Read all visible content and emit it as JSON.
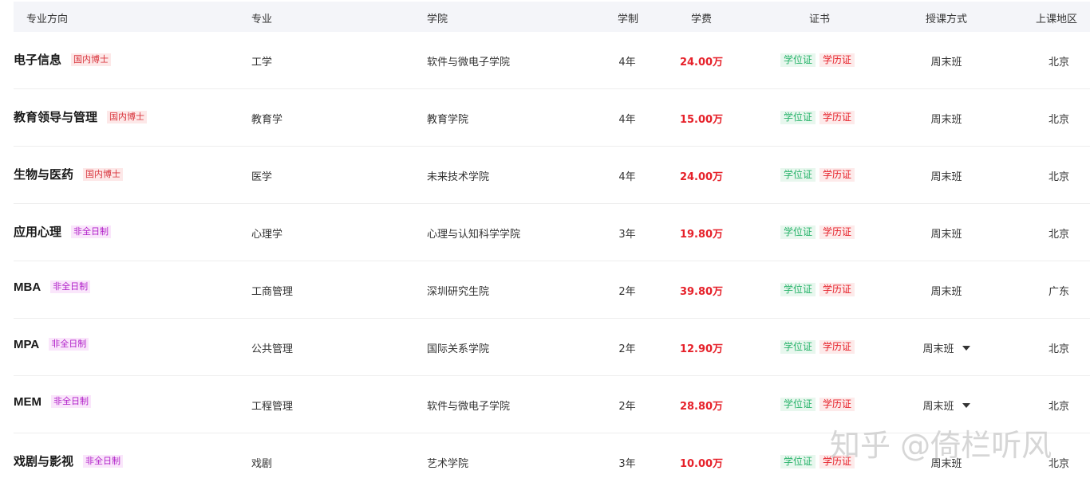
{
  "header": {
    "direction": "专业方向",
    "major": "专业",
    "college": "学院",
    "duration": "学制",
    "fee": "学费",
    "certificate": "证书",
    "mode": "授课方式",
    "region": "上课地区"
  },
  "rows": [
    {
      "direction": "电子信息",
      "tag": "国内博士",
      "tag_type": "phd",
      "major": "工学",
      "college": "软件与微电子学院",
      "duration": "4年",
      "fee": "24.00万",
      "cert1": "学位证",
      "cert2": "学历证",
      "mode": "周末班",
      "has_dropdown": false,
      "region": "北京"
    },
    {
      "direction": "教育领导与管理",
      "tag": "国内博士",
      "tag_type": "phd",
      "major": "教育学",
      "college": "教育学院",
      "duration": "4年",
      "fee": "15.00万",
      "cert1": "学位证",
      "cert2": "学历证",
      "mode": "周末班",
      "has_dropdown": false,
      "region": "北京"
    },
    {
      "direction": "生物与医药",
      "tag": "国内博士",
      "tag_type": "phd",
      "major": "医学",
      "college": "未来技术学院",
      "duration": "4年",
      "fee": "24.00万",
      "cert1": "学位证",
      "cert2": "学历证",
      "mode": "周末班",
      "has_dropdown": false,
      "region": "北京"
    },
    {
      "direction": "应用心理",
      "tag": "非全日制",
      "tag_type": "part",
      "major": "心理学",
      "college": "心理与认知科学学院",
      "duration": "3年",
      "fee": "19.80万",
      "cert1": "学位证",
      "cert2": "学历证",
      "mode": "周末班",
      "has_dropdown": false,
      "region": "北京"
    },
    {
      "direction": "MBA",
      "tag": "非全日制",
      "tag_type": "part",
      "major": "工商管理",
      "college": "深圳研究生院",
      "duration": "2年",
      "fee": "39.80万",
      "cert1": "学位证",
      "cert2": "学历证",
      "mode": "周末班",
      "has_dropdown": false,
      "region": "广东"
    },
    {
      "direction": "MPA",
      "tag": "非全日制",
      "tag_type": "part",
      "major": "公共管理",
      "college": "国际关系学院",
      "duration": "2年",
      "fee": "12.90万",
      "cert1": "学位证",
      "cert2": "学历证",
      "mode": "周末班",
      "has_dropdown": true,
      "region": "北京"
    },
    {
      "direction": "MEM",
      "tag": "非全日制",
      "tag_type": "part",
      "major": "工程管理",
      "college": "软件与微电子学院",
      "duration": "2年",
      "fee": "28.80万",
      "cert1": "学位证",
      "cert2": "学历证",
      "mode": "周末班",
      "has_dropdown": true,
      "region": "北京"
    },
    {
      "direction": "戏剧与影视",
      "tag": "非全日制",
      "tag_type": "part",
      "major": "戏剧",
      "college": "艺术学院",
      "duration": "3年",
      "fee": "10.00万",
      "cert1": "学位证",
      "cert2": "学历证",
      "mode": "周末班",
      "has_dropdown": false,
      "region": "北京"
    }
  ],
  "watermark": "知乎 @倚栏听风",
  "colors": {
    "header_bg": "#f4f5f9",
    "fee": "#e6212a",
    "tag_phd": "#d9363e",
    "tag_part_time": "#b01ec8",
    "cert_degree": "#27b36a",
    "cert_diploma": "#e6212a"
  },
  "icons": {
    "dropdown": "caret-down-icon"
  }
}
